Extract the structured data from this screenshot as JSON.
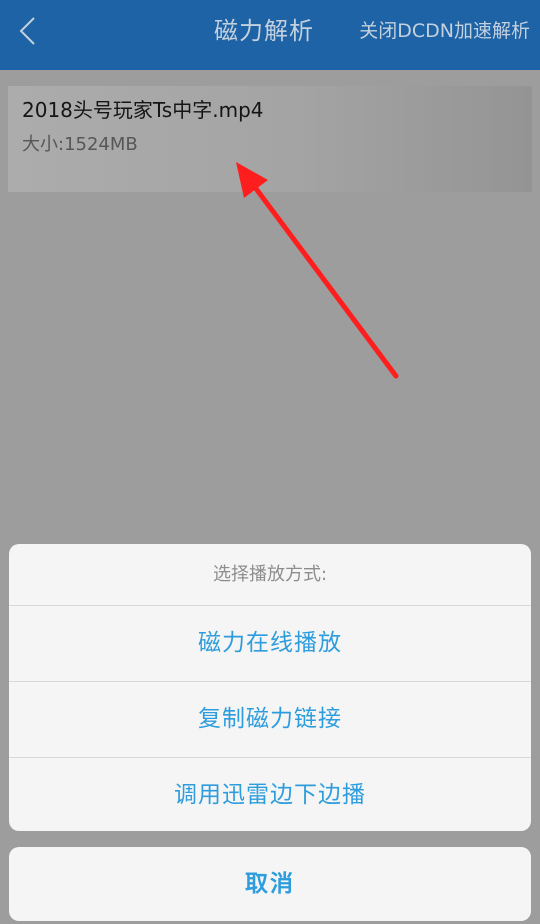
{
  "header": {
    "title": "磁力解析",
    "action_label": "关闭DCDN加速解析",
    "back_icon": "chevron-left-icon"
  },
  "file": {
    "name": "2018头号玩家Ts中字.mp4",
    "size": "大小:1524MB"
  },
  "annotation": {
    "arrow_color": "#ff1e1e"
  },
  "sheet": {
    "title": "选择播放方式:",
    "options": [
      {
        "label": "磁力在线播放"
      },
      {
        "label": "复制磁力链接"
      },
      {
        "label": "调用迅雷边下边播"
      }
    ],
    "cancel_label": "取消"
  },
  "colors": {
    "header_bg": "#1e63a6",
    "accent": "#2d9ddd",
    "overlay": "#9d9d9d"
  }
}
